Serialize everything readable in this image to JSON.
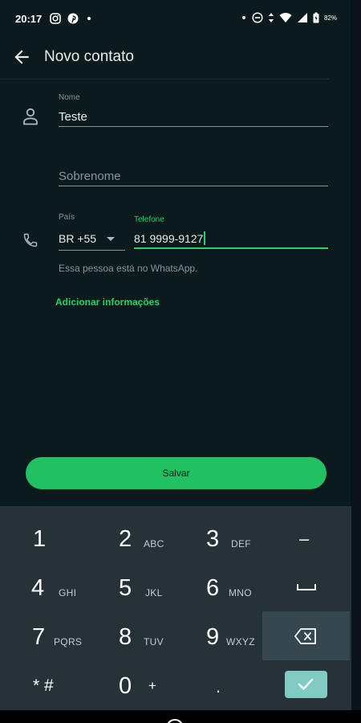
{
  "status_bar": {
    "time": "20:17",
    "battery": "82%",
    "left_icons": [
      "instagram-icon",
      "pinterest-icon",
      "dot-icon"
    ],
    "right_icons": [
      "dot-icon",
      "do-not-disturb-icon",
      "data-arrows-icon",
      "wifi-icon",
      "signal-icon",
      "battery-icon"
    ]
  },
  "app_bar": {
    "title": "Novo contato",
    "back_icon": "arrow-back-icon"
  },
  "form": {
    "first_name": {
      "label": "Nome",
      "value": "Teste"
    },
    "last_name": {
      "placeholder": "Sobrenome"
    },
    "country": {
      "label": "País",
      "value": "BR +55"
    },
    "phone": {
      "label": "Telefone",
      "value": "81 9999-9127"
    },
    "helper_text": "Essa pessoa está no WhatsApp.",
    "add_info_label": "Adicionar informações"
  },
  "save_label": "Salvar",
  "colors": {
    "accent": "#25d366",
    "background": "#0b1a1d",
    "keypad": "#263238",
    "save_button": "#21c063"
  },
  "keypad": {
    "keys": [
      {
        "num": "1",
        "letters": ""
      },
      {
        "num": "2",
        "letters": "ABC"
      },
      {
        "num": "3",
        "letters": "DEF"
      },
      {
        "num": "–",
        "letters": ""
      },
      {
        "num": "4",
        "letters": "GHI"
      },
      {
        "num": "5",
        "letters": "JKL"
      },
      {
        "num": "6",
        "letters": "MNO"
      },
      {
        "num": "␣",
        "letters": ""
      },
      {
        "num": "7",
        "letters": "PQRS"
      },
      {
        "num": "8",
        "letters": "TUV"
      },
      {
        "num": "9",
        "letters": "WXYZ"
      },
      {
        "num": "⌫",
        "letters": ""
      },
      {
        "num": "* #",
        "letters": ""
      },
      {
        "num": "0",
        "letters": "+"
      },
      {
        "num": ".",
        "letters": ""
      },
      {
        "num": "✓",
        "letters": ""
      }
    ]
  }
}
